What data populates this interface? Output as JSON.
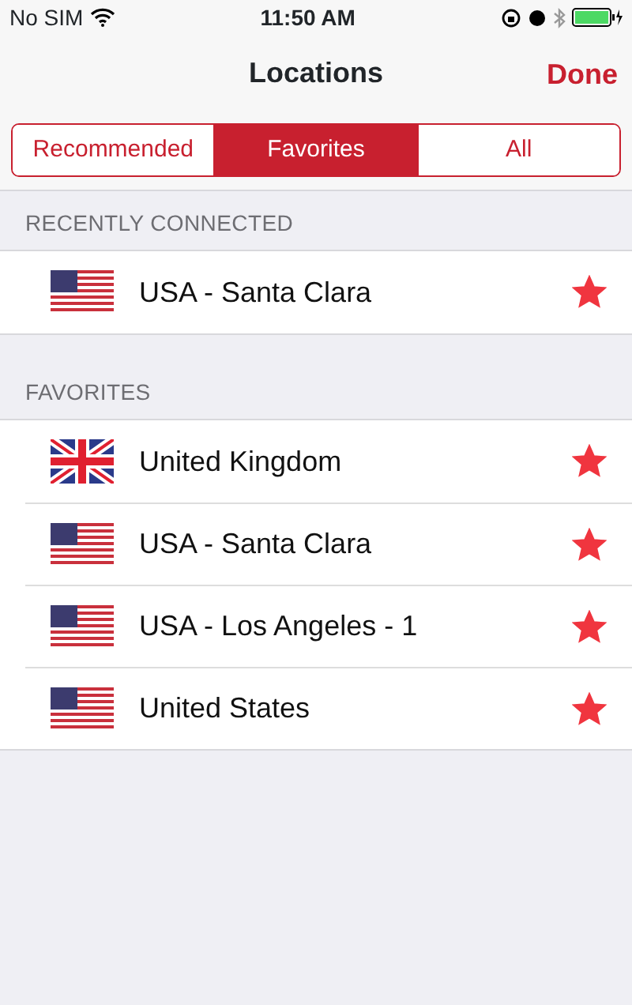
{
  "status_bar": {
    "carrier": "No SIM",
    "time": "11:50 AM"
  },
  "nav": {
    "title": "Locations",
    "done": "Done"
  },
  "tabs": [
    {
      "label": "Recommended",
      "selected": false
    },
    {
      "label": "Favorites",
      "selected": true
    },
    {
      "label": "All",
      "selected": false
    }
  ],
  "sections": [
    {
      "header": "RECENTLY CONNECTED",
      "rows": [
        {
          "kind": "us",
          "name": "USA - Santa Clara",
          "favorite": true
        }
      ]
    },
    {
      "header": "FAVORITES",
      "rows": [
        {
          "kind": "uk",
          "name": "United Kingdom",
          "favorite": true
        },
        {
          "kind": "us",
          "name": "USA - Santa Clara",
          "favorite": true
        },
        {
          "kind": "us",
          "name": "USA - Los Angeles - 1",
          "favorite": true
        },
        {
          "kind": "us",
          "name": "United States",
          "favorite": true
        }
      ]
    }
  ]
}
